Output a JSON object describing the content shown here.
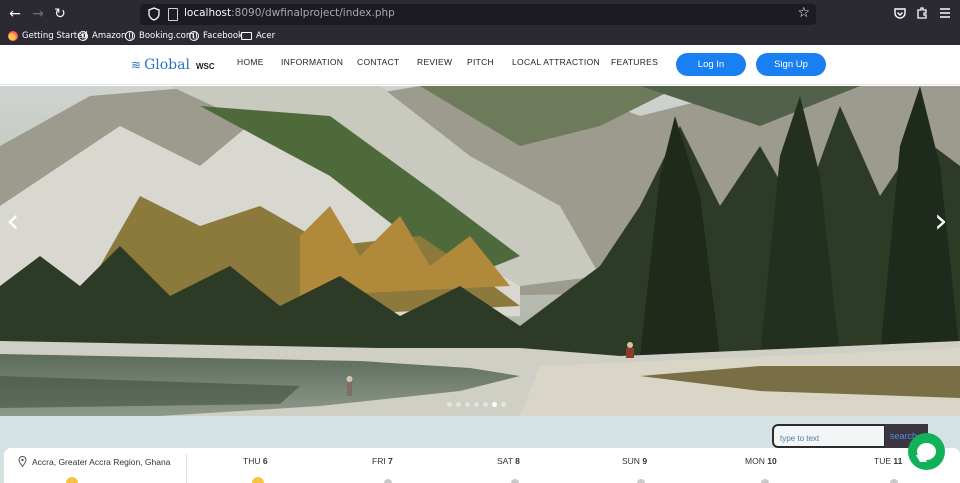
{
  "browser": {
    "url_host": "localhost",
    "url_rest": ":8090/dwfinalproject/index.php",
    "bookmarks": [
      "Getting Started",
      "Amazon",
      "Booking.com",
      "Facebook",
      "Acer"
    ]
  },
  "site": {
    "logo_text": "Global",
    "logo_sub": "WSC",
    "menu": [
      "HOME",
      "INFORMATION",
      "CONTACT",
      "REVIEW",
      "PITCH",
      "LOCAL ATTRACTION",
      "FEATURES"
    ],
    "login_label": "Log In",
    "signup_label": "Sign Up"
  },
  "hero": {
    "slides": 7,
    "active_slide": 6,
    "prev_arrow": "‹",
    "next_arrow": "›"
  },
  "search": {
    "placeholder": "type to text",
    "button_label": "search"
  },
  "weather": {
    "location": "Accra, Greater Accra Region, Ghana",
    "days": [
      {
        "name": "THU",
        "date": "6"
      },
      {
        "name": "FRI",
        "date": "7"
      },
      {
        "name": "SAT",
        "date": "8"
      },
      {
        "name": "SUN",
        "date": "9"
      },
      {
        "name": "MON",
        "date": "10"
      },
      {
        "name": "TUE",
        "date": "11"
      }
    ]
  },
  "colors": {
    "primary_button": "#1a7ff0",
    "chat_button": "#13b05a",
    "band": "#d5e2e4"
  }
}
